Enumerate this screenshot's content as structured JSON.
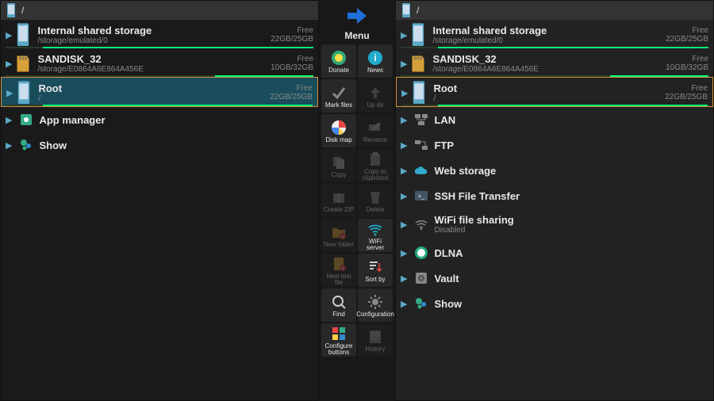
{
  "left": {
    "path": "/",
    "storage": [
      {
        "title": "Internal shared storage",
        "sub": "/storage/emulated/0",
        "free": "Free",
        "size": "22GB/25GB",
        "fill": 12
      },
      {
        "title": "SANDISK_32",
        "sub": "/storage/E0864A6E864A456E",
        "free": "Free",
        "size": "10GB/32GB",
        "fill": 68
      },
      {
        "title": "Root",
        "sub": "/",
        "free": "Free",
        "size": "22GB/25GB",
        "fill": 12,
        "selected": true
      }
    ],
    "items": [
      {
        "label": "App manager",
        "icon": "app"
      },
      {
        "label": "Show",
        "icon": "show"
      }
    ]
  },
  "menu": {
    "title": "Menu",
    "items": [
      {
        "label": "Donate",
        "icon": "donate",
        "dim": false
      },
      {
        "label": "News",
        "icon": "news",
        "dim": false
      },
      {
        "label": "Mark files",
        "icon": "mark",
        "dim": false
      },
      {
        "label": "Up dir",
        "icon": "up",
        "dim": true
      },
      {
        "label": "Disk map",
        "icon": "disk",
        "dim": false
      },
      {
        "label": "Rename",
        "icon": "rename",
        "dim": true
      },
      {
        "label": "Copy",
        "icon": "copy",
        "dim": true
      },
      {
        "label": "Copy to clipboard",
        "icon": "clip",
        "dim": true
      },
      {
        "label": "Create ZIP",
        "icon": "zip",
        "dim": true
      },
      {
        "label": "Delete",
        "icon": "del",
        "dim": true
      },
      {
        "label": "New folder",
        "icon": "newf",
        "dim": true
      },
      {
        "label": "WiFi server",
        "icon": "wifi",
        "dim": false
      },
      {
        "label": "New text file",
        "icon": "newt",
        "dim": true
      },
      {
        "label": "Sort by",
        "icon": "sort",
        "dim": false
      },
      {
        "label": "Find",
        "icon": "find",
        "dim": false
      },
      {
        "label": "Configuration",
        "icon": "conf",
        "dim": false
      },
      {
        "label": "Configure buttons",
        "icon": "cbtn",
        "dim": false
      },
      {
        "label": "History",
        "icon": "hist",
        "dim": true
      }
    ]
  },
  "right": {
    "path": "/",
    "storage": [
      {
        "title": "Internal shared storage",
        "sub": "/storage/emulated/0",
        "free": "Free",
        "size": "22GB/25GB",
        "fill": 12
      },
      {
        "title": "SANDISK_32",
        "sub": "/storage/E0864A6E864A456E",
        "free": "Free",
        "size": "10GB/32GB",
        "fill": 68
      },
      {
        "title": "Root",
        "sub": "/",
        "free": "Free",
        "size": "22GB/25GB",
        "fill": 12,
        "selected": true
      }
    ],
    "items": [
      {
        "label": "LAN",
        "icon": "lan"
      },
      {
        "label": "FTP",
        "icon": "ftp"
      },
      {
        "label": "Web storage",
        "icon": "cloud"
      },
      {
        "label": "SSH File Transfer",
        "icon": "ssh"
      },
      {
        "label": "WiFi file sharing",
        "sub": "Disabled",
        "icon": "wifishare"
      },
      {
        "label": "DLNA",
        "icon": "dlna"
      },
      {
        "label": "Vault",
        "icon": "vault"
      },
      {
        "label": "Show",
        "icon": "show"
      }
    ]
  }
}
